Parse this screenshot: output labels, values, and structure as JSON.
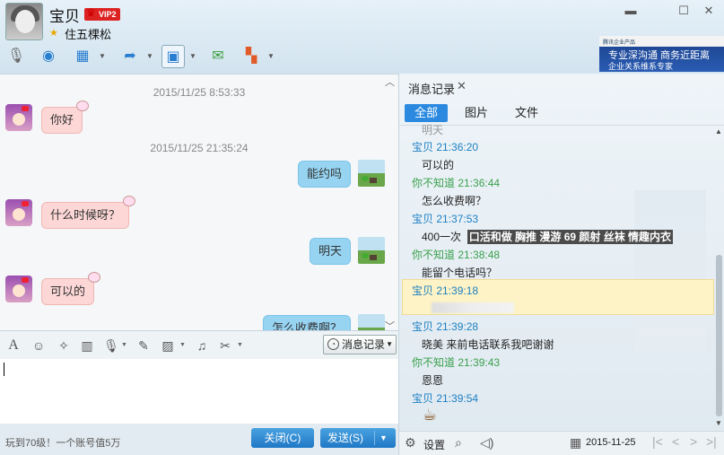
{
  "window": {
    "contact_name": "宝贝",
    "vip_label": "VIP2",
    "status": "住五棵松",
    "controls": {
      "minimize": "▬",
      "restore": "☐",
      "close": "✕"
    }
  },
  "ad": {
    "logo_text": "腾讯企业产品",
    "line1": "专业深沟通  商务近距离",
    "line2": "企业关系维系专家"
  },
  "toolbar": {
    "icons": [
      "microphone-icon",
      "video-icon",
      "screen-share-icon",
      "file-transfer-icon",
      "remote-assist-icon",
      "message-add-icon",
      "apps-icon"
    ]
  },
  "chat": {
    "collapse": "︿",
    "expand": "﹀",
    "timestamps": [
      "2015/11/25 8:53:33",
      "2015/11/25 21:35:24"
    ],
    "messages": [
      {
        "side": "in",
        "text": "你好"
      },
      {
        "side": "out",
        "text": "能约吗"
      },
      {
        "side": "in",
        "text": "什么时候呀？"
      },
      {
        "side": "out",
        "text": "明天"
      },
      {
        "side": "in",
        "text": "可以的"
      },
      {
        "side": "out",
        "text": "怎么收费啊？"
      }
    ]
  },
  "input_toolbar": {
    "icons": [
      "font-icon",
      "emoji-icon",
      "magic-icon",
      "shake-icon",
      "voice-icon",
      "edit-icon",
      "image-icon",
      "music-icon",
      "screenshot-icon"
    ],
    "record_button": "消息记录"
  },
  "bottom": {
    "promo": "玩到70级！一个账号值5万",
    "close_label": "关闭(C)",
    "send_label": "发送(S)"
  },
  "history": {
    "tab_label": "消息记录",
    "tab_close": "✕",
    "filters": [
      "全部",
      "图片",
      "文件"
    ],
    "top_partial": "明天",
    "entries": [
      {
        "who": "me",
        "header": "宝贝  21:36:20",
        "text": "可以的"
      },
      {
        "who": "peer",
        "header": "你不知道  21:36:44",
        "text": "怎么收费啊？"
      },
      {
        "who": "me",
        "header": "宝贝  21:37:53",
        "text": "400一次",
        "banner": "口活和做 胸推 漫游 69 颜射  丝袜 情趣内衣"
      },
      {
        "who": "peer",
        "header": "你不知道  21:38:48",
        "text": "能留个电话吗？"
      },
      {
        "who": "me",
        "header": "宝贝  21:39:18",
        "text": ""
      },
      {
        "who": "me",
        "header": "宝贝  21:39:28",
        "text": "晓美 来前电话联系我吧谢谢"
      },
      {
        "who": "peer",
        "header": "你不知道  21:39:43",
        "text": "恩恩"
      },
      {
        "who": "me",
        "header": "宝贝  21:39:54",
        "text": ""
      }
    ],
    "settings_label": "设置",
    "date": "2015-11-25",
    "pager": [
      "|<",
      "<",
      ">",
      ">|"
    ]
  }
}
